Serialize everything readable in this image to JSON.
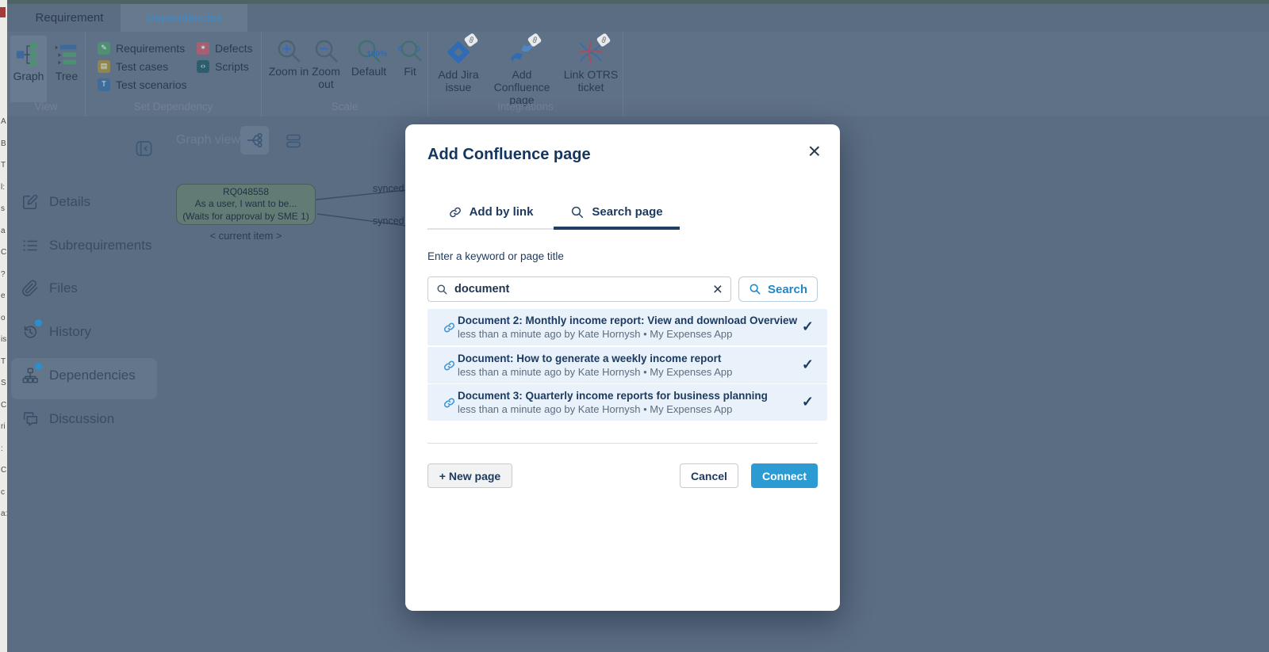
{
  "tab_bar": {
    "tabs": [
      {
        "label": "Requirement",
        "active": false
      },
      {
        "label": "Dependencies",
        "active": true
      }
    ]
  },
  "ribbon": {
    "groups": [
      {
        "label": "View",
        "buttons": [
          {
            "label": "Graph",
            "active": true
          },
          {
            "label": "Tree",
            "active": false
          }
        ]
      },
      {
        "label": "Set Dependency",
        "items": [
          {
            "label": "Requirements"
          },
          {
            "label": "Test cases"
          },
          {
            "label": "Test scenarios"
          },
          {
            "label": "Defects"
          },
          {
            "label": "Scripts"
          }
        ]
      },
      {
        "label": "Scale",
        "buttons": [
          {
            "label": "Zoom in"
          },
          {
            "label": "Zoom out"
          },
          {
            "label": "Default",
            "badge": "100%"
          },
          {
            "label": "Fit"
          }
        ]
      },
      {
        "label": "Integrations",
        "buttons": [
          {
            "label": "Add Jira issue"
          },
          {
            "label": "Add Confluence page"
          },
          {
            "label": "Link OTRS ticket"
          }
        ]
      }
    ]
  },
  "sidebar": {
    "items": [
      {
        "label": "Details",
        "badge": false,
        "active": false
      },
      {
        "label": "Subrequirements",
        "badge": false,
        "active": false
      },
      {
        "label": "Files",
        "badge": false,
        "active": false
      },
      {
        "label": "History",
        "badge": true,
        "active": false
      },
      {
        "label": "Dependencies",
        "badge": true,
        "active": true
      },
      {
        "label": "Discussion",
        "badge": false,
        "active": false
      }
    ]
  },
  "graph": {
    "view_label": "Graph view",
    "node": {
      "id": "RQ048558",
      "line2": "As a user, I want to be...",
      "line3": "(Waits for approval by SME 1)"
    },
    "caption": "< current item >",
    "edge_labels": [
      "synced",
      "synced"
    ]
  },
  "modal": {
    "title": "Add Confluence page",
    "close_glyph": "×",
    "tabs": [
      {
        "label": "Add by link",
        "active": false
      },
      {
        "label": "Search page",
        "active": true
      }
    ],
    "search": {
      "label": "Enter a keyword or page title",
      "value": "document",
      "button": "Search",
      "clear_glyph": "×"
    },
    "results": [
      {
        "title": "Document 2: Monthly income report: View and download Overview",
        "meta": "less than a minute ago by Kate Hornysh • My Expenses App",
        "check_glyph": "✓"
      },
      {
        "title": "Document: How to generate a weekly income report",
        "meta": "less than a minute ago by Kate Hornysh • My Expenses App",
        "check_glyph": "✓"
      },
      {
        "title": "Document 3: Quarterly income reports for business planning",
        "meta": "less than a minute ago by Kate Hornysh • My Expenses App",
        "check_glyph": "✓"
      }
    ],
    "footer": {
      "new_page": "+ New page",
      "cancel": "Cancel",
      "connect": "Connect"
    }
  },
  "colors": {
    "connect_blue": "#2d9bd3",
    "search_blue": "#1e88c8",
    "result_row_bg": "#e9f1fa",
    "navy_text": "#1c3a5f",
    "overlay_backdrop": "#5b6d83",
    "active_tab_blue": "#4089c4"
  },
  "left_edge_fragments": "A\nB\nT\nl:\ns\na\nC\n?\ne\no\nis\nT\nS\nC\nri\n:\nC\nc\na:"
}
